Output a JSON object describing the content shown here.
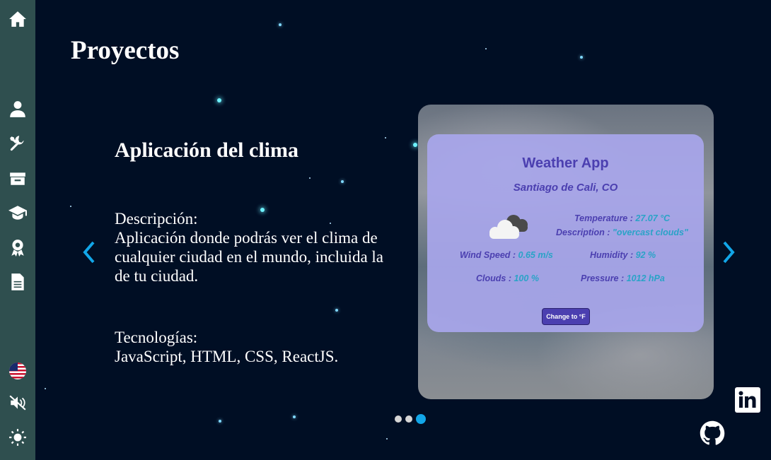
{
  "page": {
    "title": "Proyectos"
  },
  "sidebar": {
    "items": [
      {
        "icon": "home-icon"
      },
      {
        "icon": "user-icon"
      },
      {
        "icon": "tools-icon"
      },
      {
        "icon": "inbox-icon"
      },
      {
        "icon": "graduation-cap-icon"
      },
      {
        "icon": "award-icon"
      },
      {
        "icon": "document-icon"
      },
      {
        "icon": "us-flag-icon"
      },
      {
        "icon": "sound-muted-icon"
      },
      {
        "icon": "sun-icon"
      }
    ]
  },
  "project": {
    "title": "Aplicación del clima",
    "description_label": "Descripción:",
    "description": "Aplicación donde podrás ver el clima de cualquier ciudad en el mundo, incluida la de tu ciudad.",
    "technologies_label": "Tecnologías:",
    "technologies": "JavaScript, HTML, CSS, ReactJS."
  },
  "weather_card": {
    "title": "Weather App",
    "city": "Santiago de Cali, CO",
    "temperature_label": "Temperature :",
    "temperature_value": "27.07 °C",
    "description_label": "Description :",
    "description_value": "\"overcast clouds\"",
    "wind_label": "Wind Speed :",
    "wind_value": "0.65 m/s",
    "humidity_label": "Humidity :",
    "humidity_value": "92 %",
    "clouds_label": "Clouds :",
    "clouds_value": "100 %",
    "pressure_label": "Pressure :",
    "pressure_value": "1012 hPa",
    "button_label": "Change to °F"
  },
  "carousel": {
    "slides": 3,
    "active_index": 2
  },
  "social": [
    {
      "icon": "linkedin-icon"
    },
    {
      "icon": "github-icon"
    }
  ],
  "colors": {
    "background": "#000e24",
    "sidebar": "#2f4f4f",
    "accent": "#12a6e8",
    "weather_primary": "#4b3fb0",
    "weather_value": "#2aa3c7"
  }
}
